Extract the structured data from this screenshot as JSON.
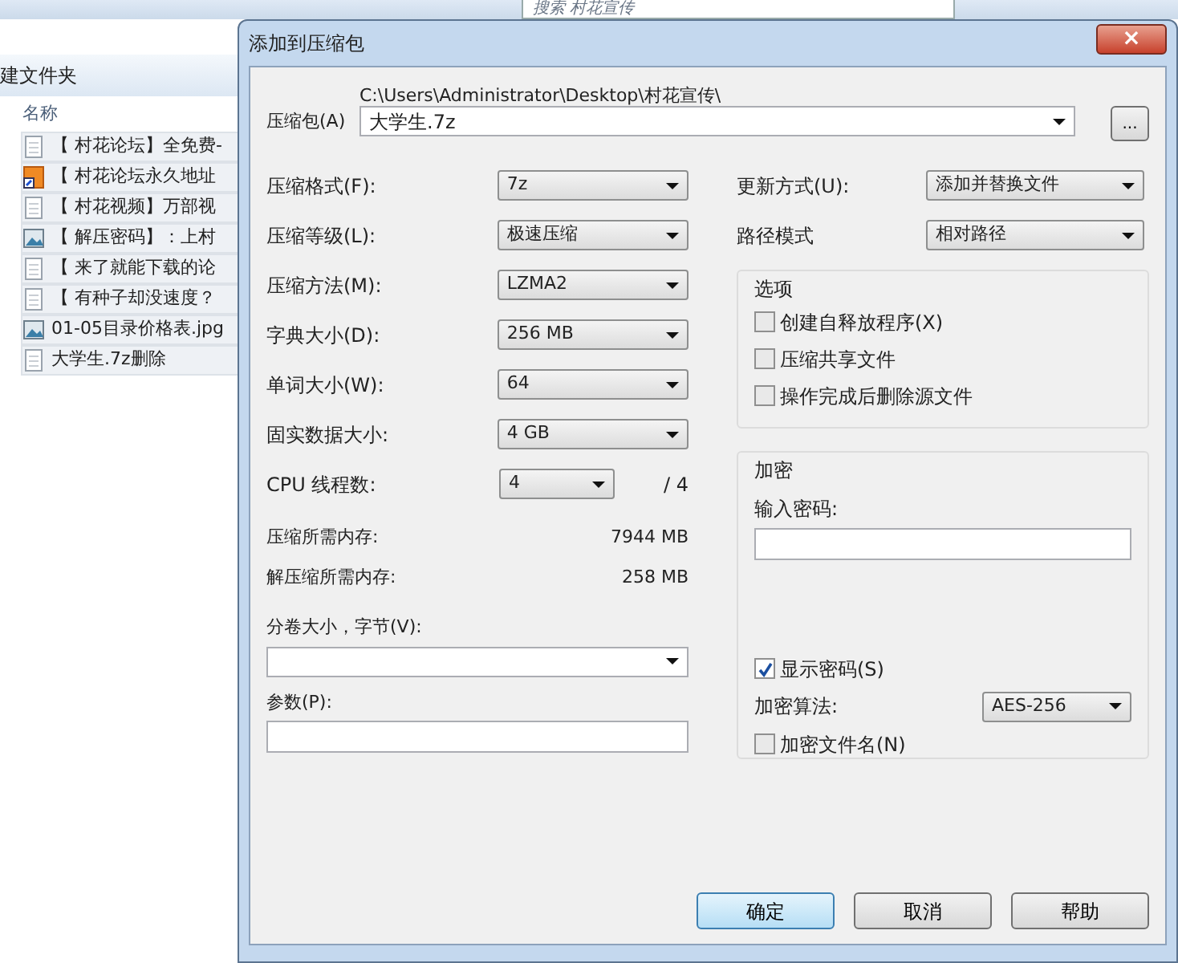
{
  "explorer": {
    "search_placeholder": "搜索 村花宣传",
    "toolbar_label": "建文件夹",
    "column_header": "名称",
    "files": [
      {
        "name": "【 村花论坛】全免费-",
        "kind": "text",
        "selected": true
      },
      {
        "name": "【 村花论坛永久地址",
        "kind": "shortcut",
        "selected": true
      },
      {
        "name": "【 村花视频】万部视",
        "kind": "text",
        "selected": true
      },
      {
        "name": "【 解压密码】：上村",
        "kind": "image",
        "selected": true
      },
      {
        "name": "【 来了就能下载的论",
        "kind": "text",
        "selected": true
      },
      {
        "name": "【 有种子却没速度？",
        "kind": "text",
        "selected": true
      },
      {
        "name": "01-05目录价格表.jpg",
        "kind": "image",
        "selected": true
      },
      {
        "name": "大学生.7z删除",
        "kind": "text",
        "selected": true
      }
    ]
  },
  "dialog": {
    "title": "添加到压缩包",
    "close": "×",
    "archive": {
      "label": "压缩包(A)",
      "path": "C:\\Users\\Administrator\\Desktop\\村花宣传\\",
      "name": "大学生.7z",
      "browse": "..."
    },
    "settings": [
      {
        "label": "压缩格式(F):",
        "value": "7z"
      },
      {
        "label": "压缩等级(L):",
        "value": "极速压缩"
      },
      {
        "label": "压缩方法(M):",
        "value": "LZMA2"
      },
      {
        "label": "字典大小(D):",
        "value": "256 MB"
      },
      {
        "label": "单词大小(W):",
        "value": "64"
      },
      {
        "label": "固实数据大小:",
        "value": "4 GB"
      }
    ],
    "cpu": {
      "label": "CPU 线程数:",
      "value": "4",
      "total": "/ 4"
    },
    "memory": [
      {
        "label": "压缩所需内存:",
        "value": "7944 MB"
      },
      {
        "label": "解压缩所需内存:",
        "value": "258 MB"
      }
    ],
    "volume": {
      "label": "分卷大小，字节(V):"
    },
    "params": {
      "label": "参数(P):"
    },
    "update": {
      "label": "更新方式(U):",
      "value": "添加并替换文件"
    },
    "path_mode": {
      "label": "路径模式",
      "value": "相对路径"
    },
    "options": {
      "title": "选项",
      "items": [
        {
          "label": "创建自释放程序(X)",
          "checked": false
        },
        {
          "label": "压缩共享文件",
          "checked": false
        },
        {
          "label": "操作完成后删除源文件",
          "checked": false
        }
      ]
    },
    "encryption": {
      "title": "加密",
      "password_label": "输入密码:",
      "show_password": {
        "label": "显示密码(S)",
        "checked": true
      },
      "method": {
        "label": "加密算法:",
        "value": "AES-256"
      },
      "encrypt_names": {
        "label": "加密文件名(N)",
        "checked": false
      }
    },
    "buttons": [
      {
        "label": "确定",
        "default": true
      },
      {
        "label": "取消",
        "default": false
      },
      {
        "label": "帮助",
        "default": false
      }
    ]
  }
}
